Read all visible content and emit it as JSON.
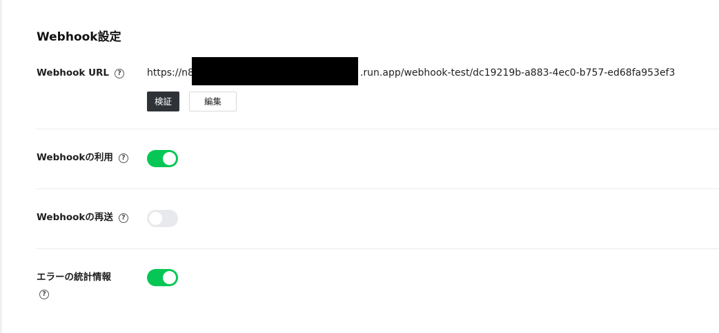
{
  "section": {
    "title": "Webhook設定"
  },
  "webhook_url": {
    "label": "Webhook URL",
    "url_prefix": "https://n8",
    "url_suffix": ".run.app/webhook-test/dc19219b-a883-4ec0-b757-ed68fa953ef3",
    "verify_label": "検証",
    "edit_label": "編集"
  },
  "usage": {
    "label": "Webhookの利用",
    "enabled": true
  },
  "resend": {
    "label": "Webhookの再送",
    "enabled": false
  },
  "error_stats": {
    "label": "エラーの統計情報",
    "enabled": true
  },
  "help_icon_glyph": "?",
  "colors": {
    "toggle_on": "#06c755",
    "toggle_off": "#e7e9ec",
    "primary_button": "#2f3338"
  }
}
